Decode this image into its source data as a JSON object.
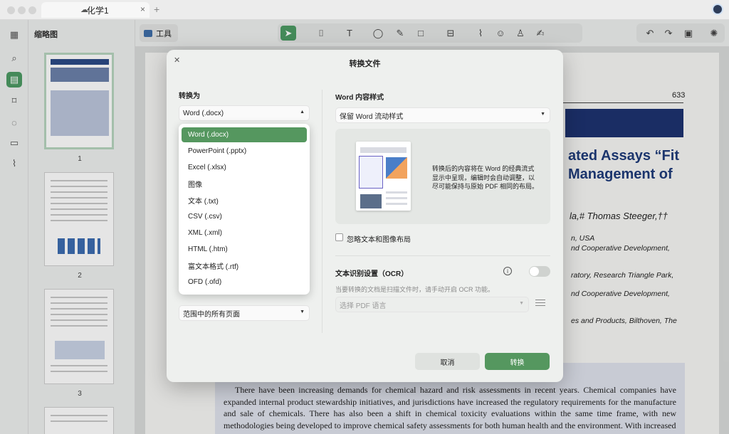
{
  "window": {
    "tab_title": "化学1",
    "tab_icon": "cloud-icon"
  },
  "sidebar": {
    "thumbnails_title": "缩略图",
    "pages": [
      {
        "label": "1"
      },
      {
        "label": "2"
      },
      {
        "label": "3"
      }
    ]
  },
  "toolbar": {
    "tools_label": "工具",
    "close_label": "关闭"
  },
  "document": {
    "page_number": "633",
    "title_line1": "ated Assays “Fit",
    "title_line2": "Management of",
    "authors": "la,# Thomas Steeger,††",
    "affiliations": [
      "n, USA",
      "nd Cooperative Development,",
      "ratory, Research Triangle Park,",
      "nd Cooperative Development,",
      "es and Products, Bilthoven, The"
    ],
    "abstract_text": "There have been increasing demands for chemical hazard and risk assessments in recent years. Chemical companies have expanded internal product stewardship initiatives, and jurisdictions have increased the regulatory requirements for the manufacture and sale of chemicals. There has also been a shift in chemical toxicity evaluations within the same time frame, with new methodologies being developed to improve chemical safety assessments for both human health and the environment. With increased"
  },
  "modal": {
    "title": "转换文件",
    "convert_to_label": "转换为",
    "format_selected": "Word (.docx)",
    "format_options": [
      "Word (.docx)",
      "PowerPoint (.pptx)",
      "Excel (.xlsx)",
      "图像",
      "文本 (.txt)",
      "CSV (.csv)",
      "XML (.xml)",
      "HTML (.htm)",
      "富文本格式 (.rtf)",
      "OFD (.ofd)"
    ],
    "page_range": "范围中的所有页面",
    "word_style_label": "Word 内容样式",
    "word_style_value": "保留 Word 流动样式",
    "preview_description": "转换后的内容将在 Word 的经典流式显示中呈现，编辑时会自动调整，以尽可能保持与原始 PDF 相同的布局。",
    "ignore_layout_label": "忽略文本和图像布局",
    "ocr_label": "文本识别设置（OCR）",
    "ocr_hint": "当要转换的文档是扫描文件时，请手动开启 OCR 功能。",
    "ocr_enabled": false,
    "language_placeholder": "选择 PDF 语言",
    "cancel_label": "取消",
    "convert_label": "转换"
  },
  "colors": {
    "accent": "#55975f",
    "doc_blue": "#1f3b7a"
  }
}
